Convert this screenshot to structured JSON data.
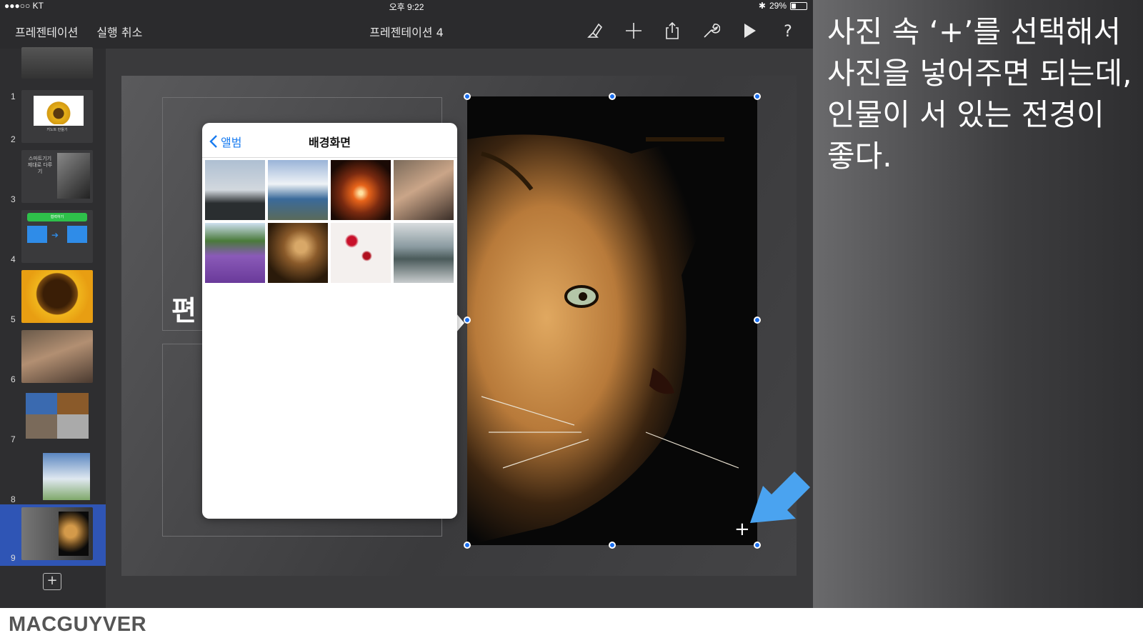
{
  "status_bar": {
    "carrier": "●●●○○ KT",
    "time": "오후 9:22",
    "battery": "29%",
    "battery_level": 0.29
  },
  "toolbar": {
    "presentations_label": "프레젠테이션",
    "undo_label": "실행 취소",
    "document_title": "프레젠테이션 4",
    "icons": [
      "format-brush-icon",
      "plus-icon",
      "share-icon",
      "wrench-icon",
      "play-icon",
      "help-icon"
    ]
  },
  "sidebar": {
    "slides": [
      {
        "number": "1"
      },
      {
        "number": "2",
        "thumb_text": "키노트 만들기"
      },
      {
        "number": "3",
        "thumb_text": "스마트기기 제대로 다루기"
      },
      {
        "number": "4",
        "thumb_text": "협력하기"
      },
      {
        "number": "5"
      },
      {
        "number": "6"
      },
      {
        "number": "7"
      },
      {
        "number": "8"
      },
      {
        "number": "9",
        "selected": true
      }
    ]
  },
  "slide": {
    "partial_text": "편"
  },
  "photo_picker": {
    "back_label": "앨범",
    "title": "배경화면",
    "photos": [
      "silhouette-rock",
      "lake-mountains",
      "sunset",
      "watch-hand",
      "lavender-field",
      "lion-cub",
      "red-flowers",
      "mountain-lake-person"
    ]
  },
  "selected_image": {
    "subject": "leopard",
    "placeholder_plus": "+"
  },
  "annotation": {
    "caption": "사진 속 ‘+’를 선택해서 사진을 넣어주면 되는데, 인물이 서 있는 전경이 좋다.",
    "arrow_color": "#4aa3f0"
  },
  "footer": {
    "brand": "MACGUYVER"
  },
  "colors": {
    "accent_blue": "#1a7cf0",
    "selection_blue": "#2f55b5"
  }
}
